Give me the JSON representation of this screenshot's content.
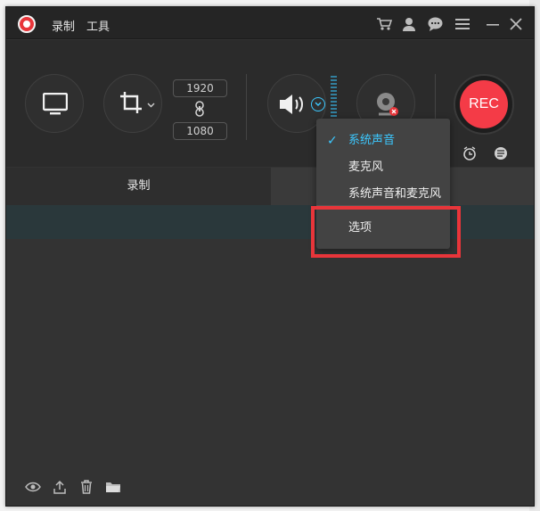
{
  "menu": {
    "record": "录制",
    "tools": "工具"
  },
  "title_icons": [
    "cart-icon",
    "user-icon",
    "chat-icon",
    "menu-icon",
    "minimize-icon",
    "close-icon"
  ],
  "resolution": {
    "width": "1920",
    "height": "1080"
  },
  "rec_label": "REC",
  "tabs": {
    "record": "录制",
    "other": ""
  },
  "dropdown": {
    "items": [
      "系统声音",
      "麦克风",
      "系统声音和麦克风",
      "选项"
    ],
    "selected_index": 0
  },
  "bottom_icons": [
    "eye-icon",
    "share-icon",
    "trash-icon",
    "folder-icon"
  ],
  "colors": {
    "accent": "#3cc8ff",
    "rec": "#f43b47",
    "highlight_frame": "#e8353a"
  }
}
